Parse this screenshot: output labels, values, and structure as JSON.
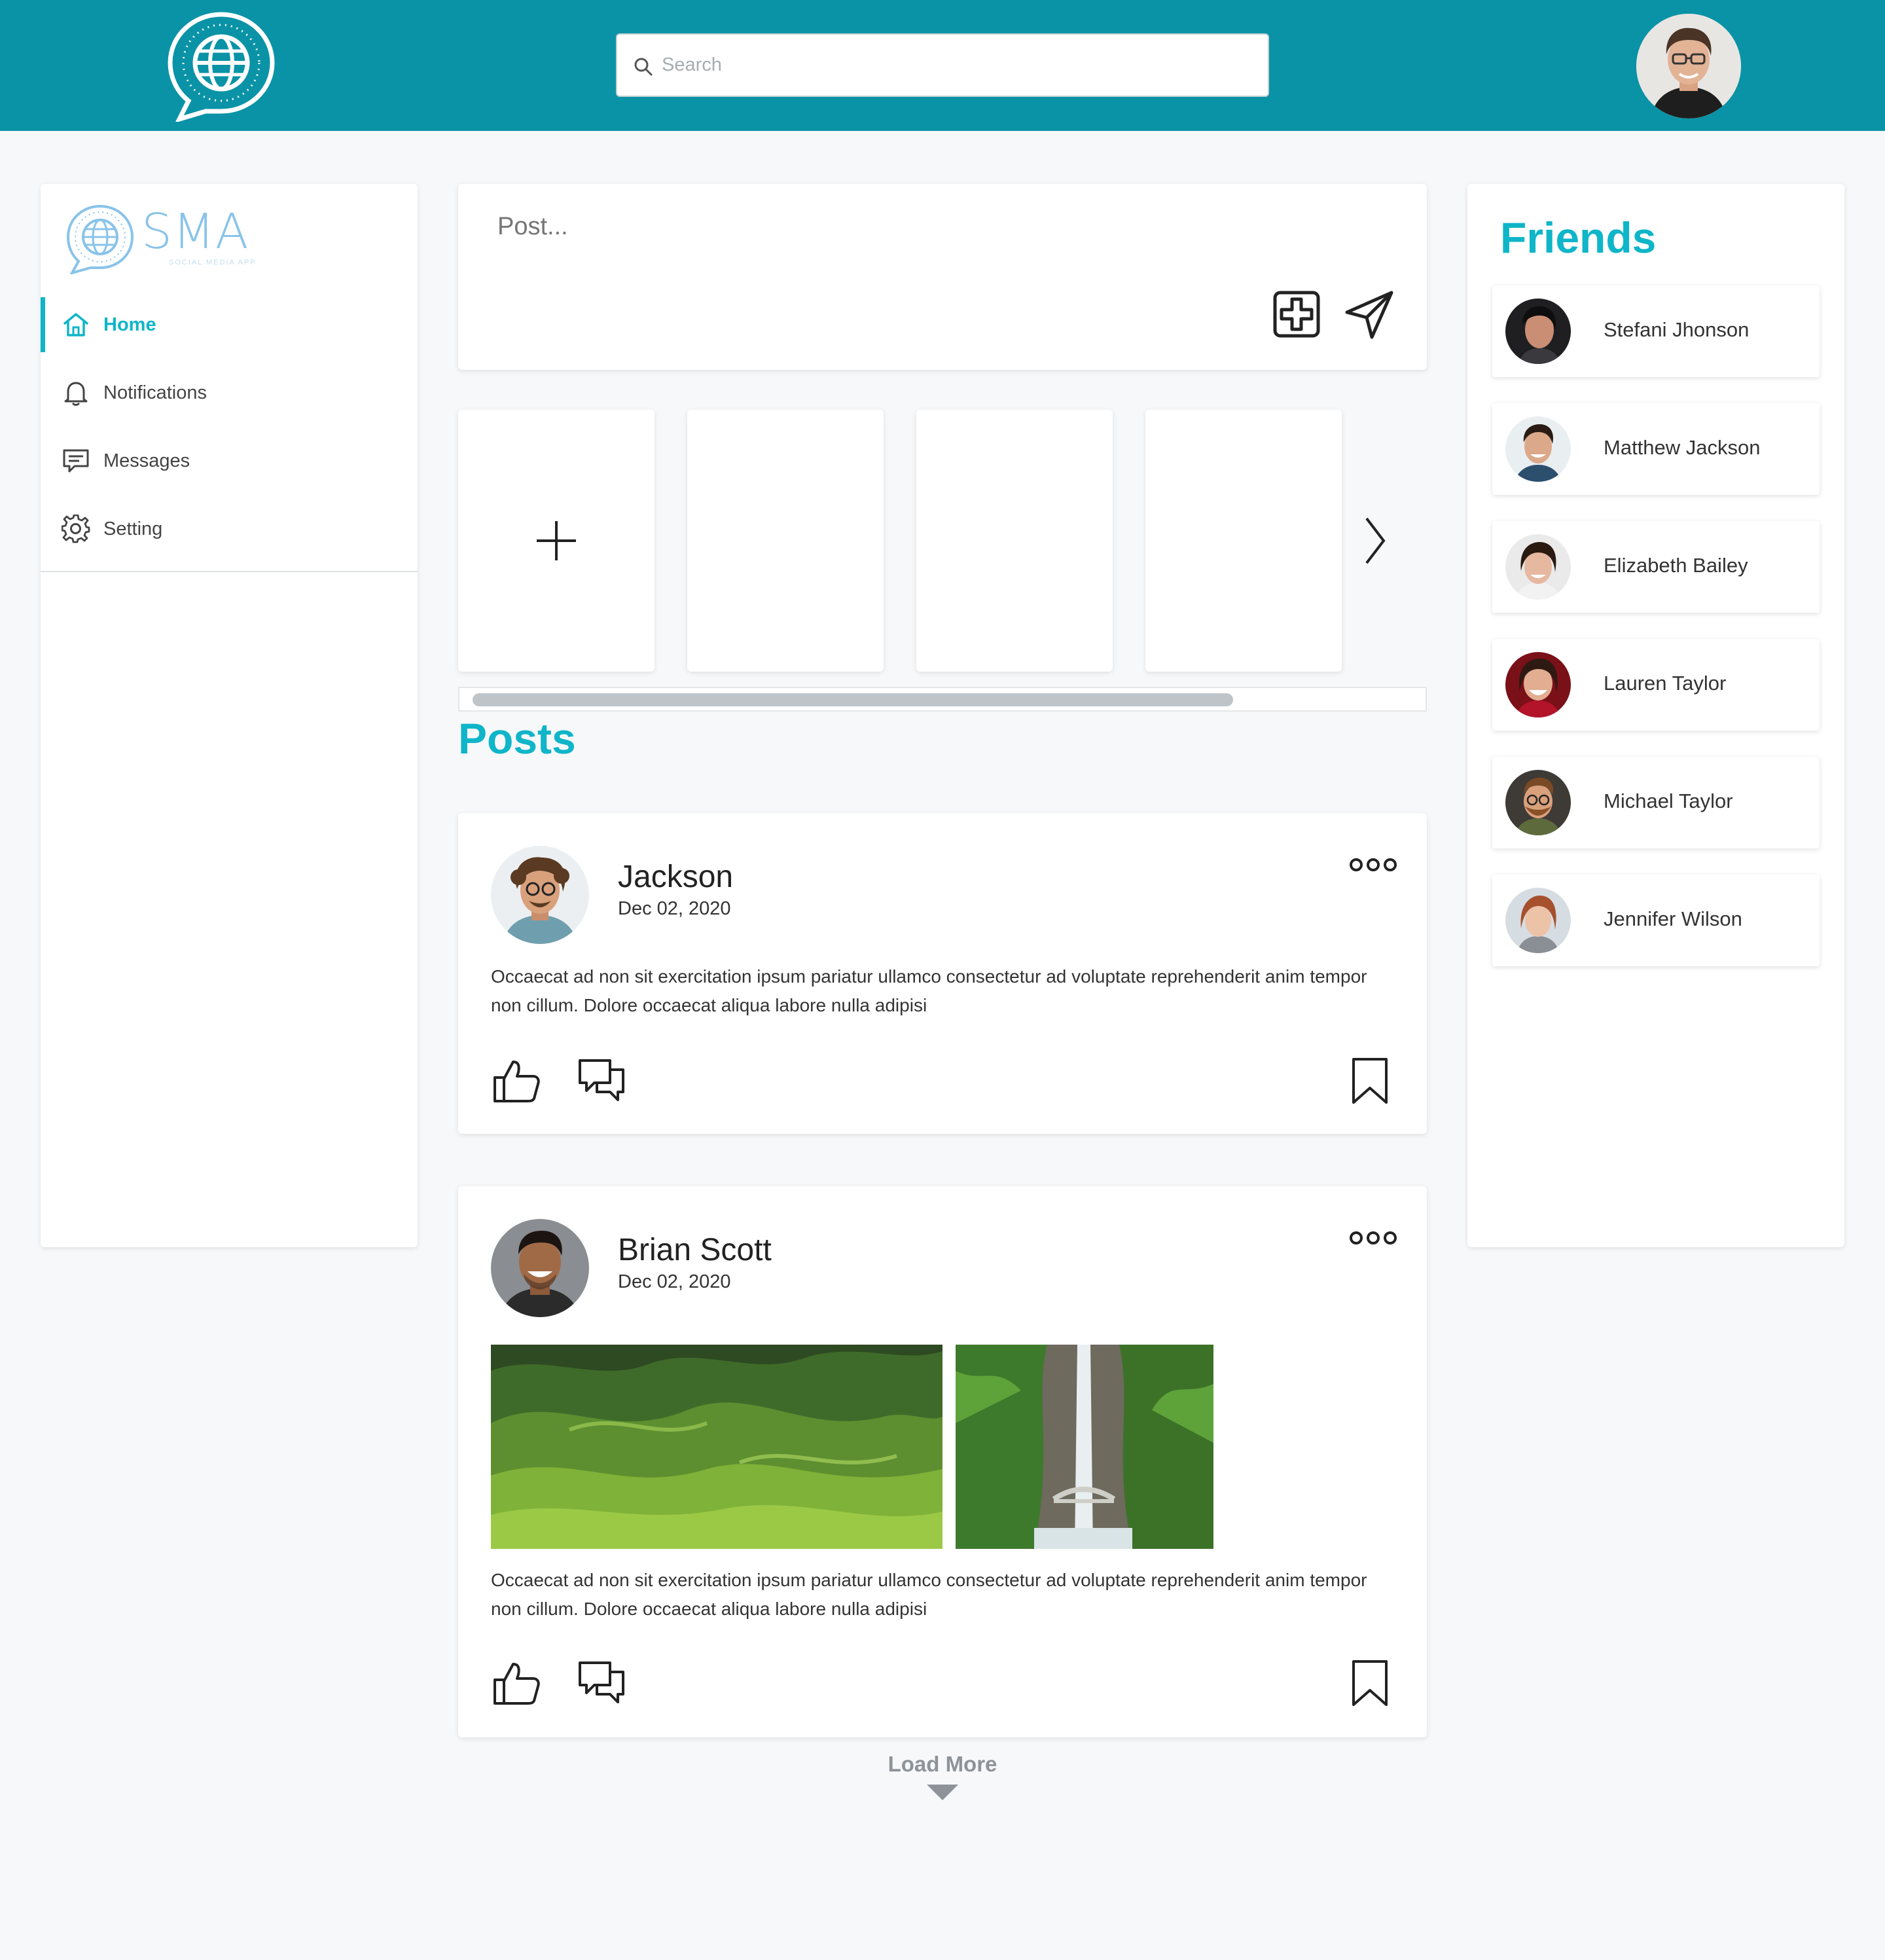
{
  "header": {
    "search_placeholder": "Search",
    "brand_color": "#0a93a6"
  },
  "sidebar": {
    "brand_name": "SMA",
    "brand_tagline": "SOCIAL MEDIA APP",
    "items": [
      {
        "label": "Home",
        "icon": "home-icon",
        "active": true
      },
      {
        "label": "Notifications",
        "icon": "bell-icon",
        "active": false
      },
      {
        "label": "Messages",
        "icon": "message-icon",
        "active": false
      },
      {
        "label": "Setting",
        "icon": "gear-icon",
        "active": false
      }
    ]
  },
  "composer": {
    "placeholder": "Post..."
  },
  "stories": {
    "add_icon": "plus-icon",
    "next_icon": "chevron-right-icon"
  },
  "posts_heading": "Posts",
  "posts": [
    {
      "author": "Jackson",
      "date": "Dec 02, 2020",
      "text": "Occaecat ad non sit exercitation ipsum pariatur ullamco consectetur ad voluptate reprehenderit anim tempor non cillum. Dolore occaecat aliqua labore nulla adipisi"
    },
    {
      "author": "Brian Scott",
      "date": "Dec 02, 2020",
      "text": "Occaecat ad non sit exercitation ipsum pariatur ullamco consectetur ad voluptate reprehenderit anim tempor non cillum. Dolore occaecat aliqua labore nulla adipisi",
      "images": [
        "green-hills-landscape",
        "waterfall-bridge-forest"
      ]
    }
  ],
  "load_more": "Load More",
  "friends": {
    "title": "Friends",
    "list": [
      {
        "name": "Stefani Jhonson"
      },
      {
        "name": "Matthew Jackson"
      },
      {
        "name": "Elizabeth Bailey"
      },
      {
        "name": "Lauren Taylor"
      },
      {
        "name": "Michael Taylor"
      },
      {
        "name": "Jennifer Wilson"
      }
    ]
  },
  "accent_color": "#0fb5c8"
}
